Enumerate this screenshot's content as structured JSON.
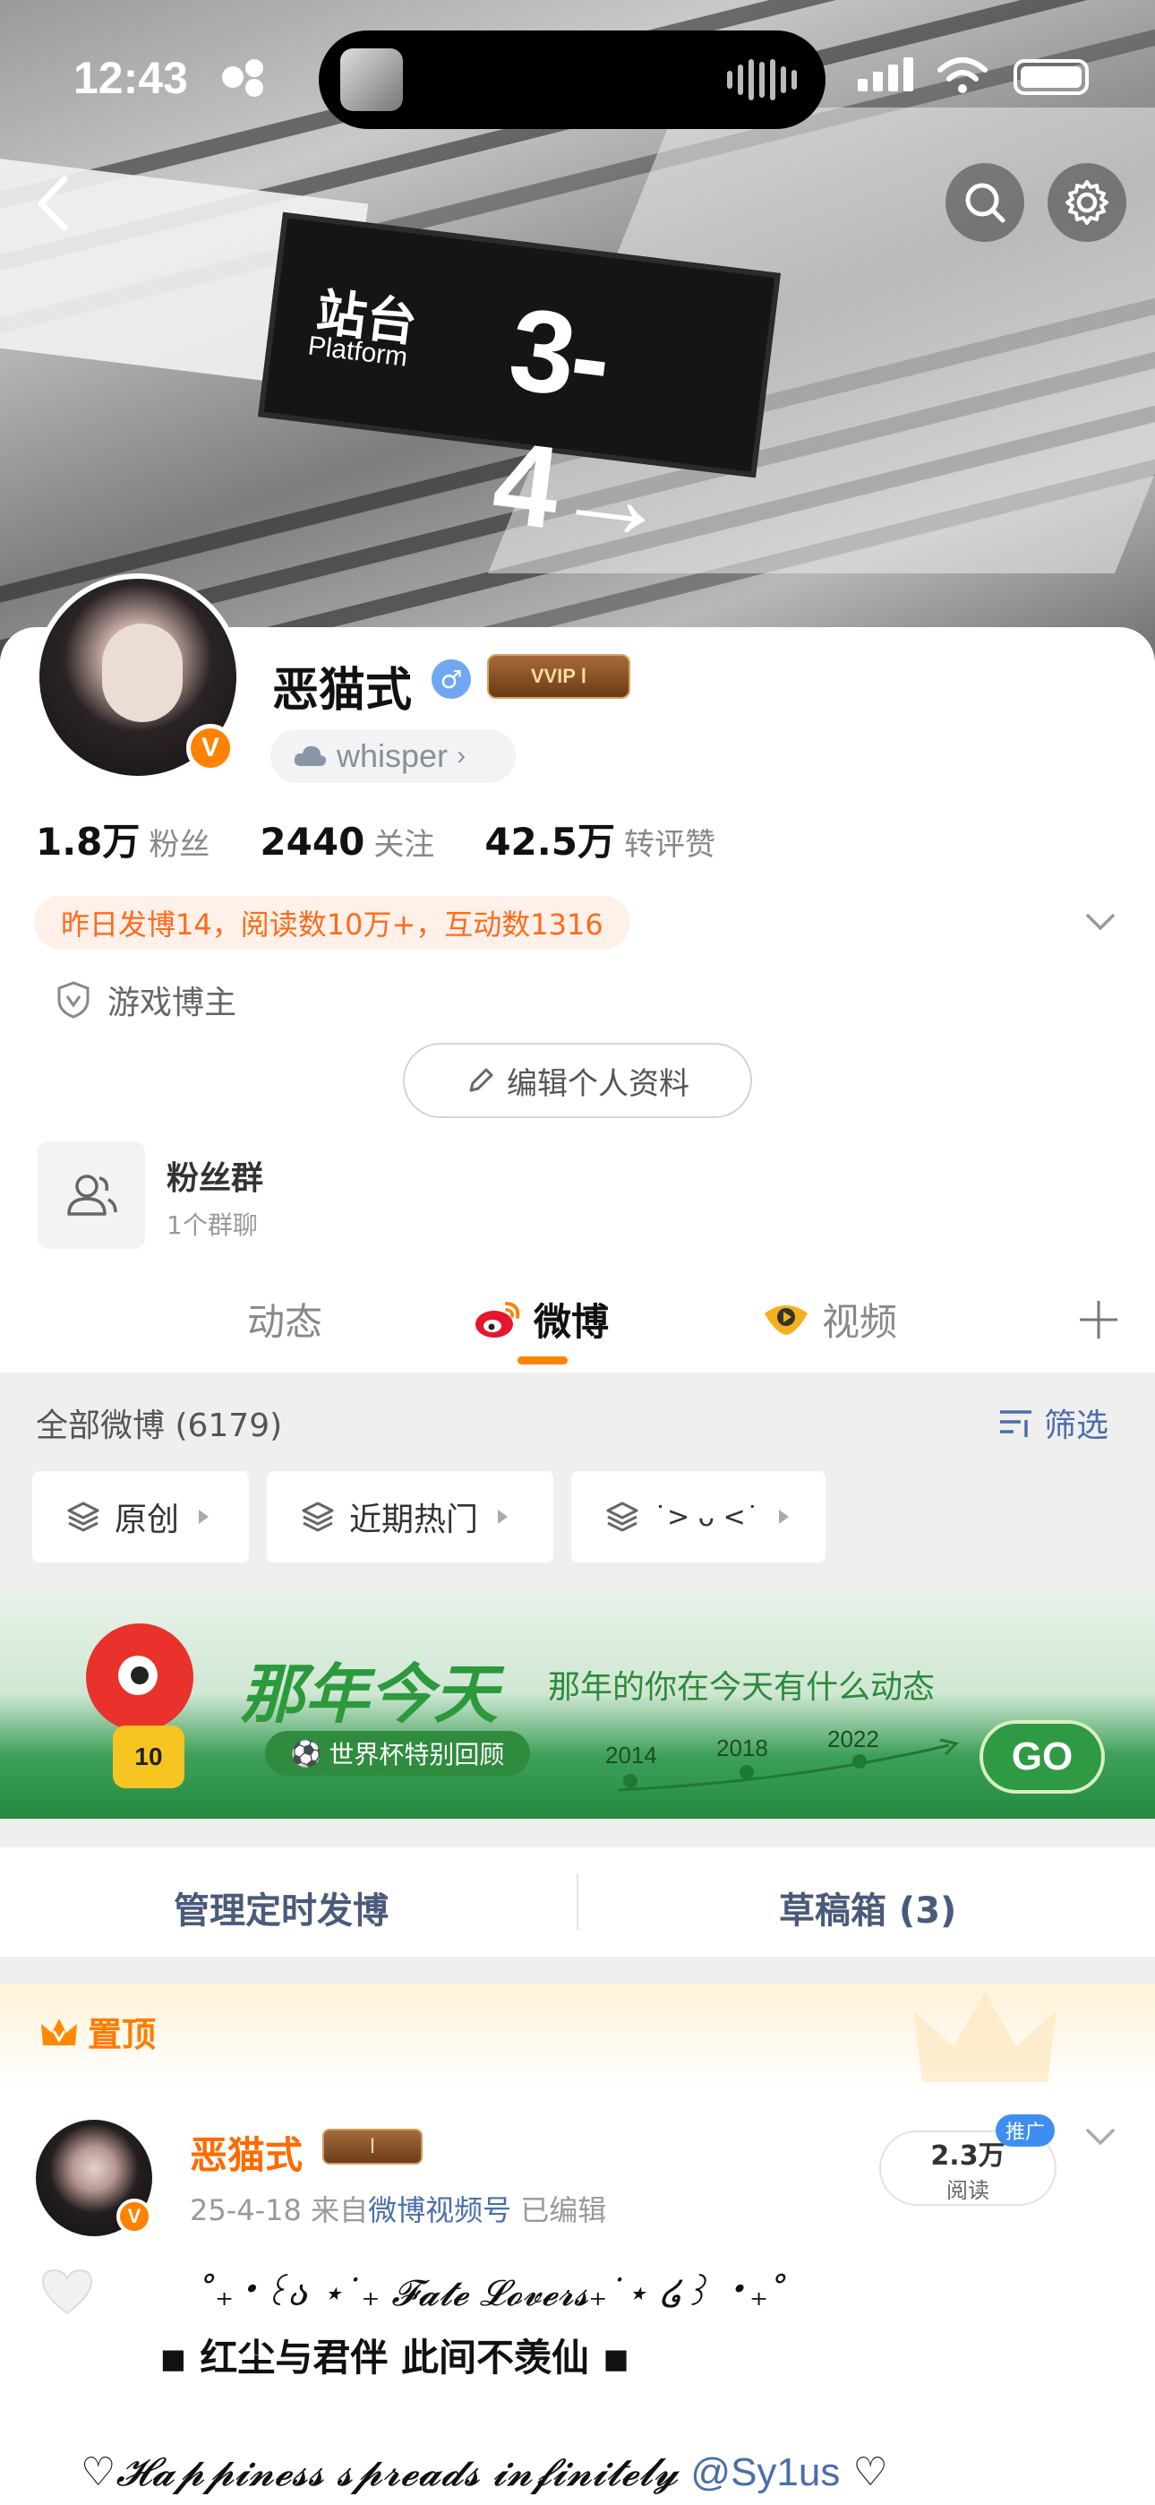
{
  "status_bar": {
    "time": "12:43"
  },
  "cover": {
    "sign_cn": "站台",
    "sign_en": "Platform",
    "sign_num": "3-4→"
  },
  "profile": {
    "name": "恶猫式",
    "gender_symbol": "♂",
    "vip_label": "VVIP Ⅰ",
    "badge_label": "whisper",
    "verify_letter": "V"
  },
  "stats": [
    {
      "value": "1.8万",
      "label": "粉丝"
    },
    {
      "value": "2440",
      "label": "关注"
    },
    {
      "value": "42.5万",
      "label": "转评赞"
    }
  ],
  "activity_text": "昨日发博14，阅读数10万+，互动数1316",
  "tag_text": "游戏博主",
  "edit_button": "编辑个人资料",
  "fan_group": {
    "title": "粉丝群",
    "subtitle": "1个群聊"
  },
  "tabs": [
    {
      "label": "动态",
      "active": false
    },
    {
      "label": "微博",
      "active": true
    },
    {
      "label": "视频",
      "active": false
    }
  ],
  "feed": {
    "all_count": "全部微博 (6179)",
    "filter_label": "筛选",
    "chips": [
      "原创",
      "近期热门",
      "˙> ᴗ <˙"
    ]
  },
  "banner": {
    "title": "那年今天",
    "subtitle": "那年的你在今天有什么动态",
    "tag": "世界杯特别回顾",
    "years": [
      "2014",
      "2018",
      "2022"
    ],
    "go": "GO",
    "mascot_number": "10"
  },
  "schedule": {
    "left": "管理定时发博",
    "right": "草稿箱 (3)"
  },
  "post": {
    "pinned_label": "置顶",
    "author": "恶猫式",
    "level": "Ⅰ",
    "date": "25-4-18",
    "source_prefix": "来自",
    "source": "微博视频号",
    "edited": "已编辑",
    "reads_value": "2.3万",
    "reads_label": "阅读",
    "promo": "推广",
    "line1": "˚₊‧꒰ა ⋆˙₊ 𝓕𝓪𝓽𝓮 𝓛𝓸𝓿𝓮𝓻𝓼₊˙⋆ ໒꒱ ‧₊˚",
    "line2": "◾ 红尘与君伴 此间不羡仙 ◾",
    "line3_text": "♡𝓗𝓪𝓹𝓹𝓲𝓷𝓮𝓼𝓼 𝓼𝓹𝓻𝓮𝓪𝓭𝓼 𝓲𝓷𝓯𝓲𝓷𝓲𝓽𝓮𝓵𝔂",
    "line3_mention": "@Sy1us",
    "line3_end": "♡"
  },
  "colors": {
    "accent": "#ff8200",
    "link": "#4a6eaa",
    "banner_green": "#2c9a3c"
  }
}
